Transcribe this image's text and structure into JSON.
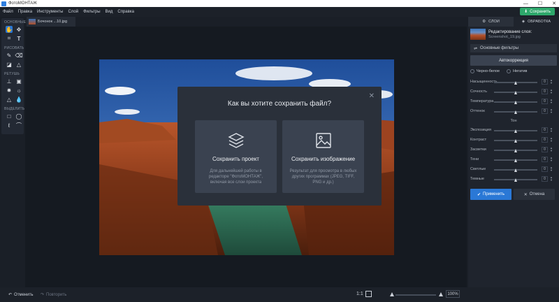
{
  "window": {
    "title": "ФотоМОНТАЖ",
    "controls": [
      "—",
      "☐",
      "✕"
    ]
  },
  "menu": [
    "Файл",
    "Правка",
    "Инструменты",
    "Слой",
    "Фильтры",
    "Вид",
    "Справка"
  ],
  "save_button": "Сохранить",
  "document_tab": "Бочонок ...10.jpg",
  "toolbar": {
    "sections": [
      "ОСНОВНЫЕ",
      "РИСОВАТЬ",
      "РЕТУШЬ",
      "ВЫДЕЛИТЬ"
    ]
  },
  "dialog": {
    "title": "Как вы хотите сохранить файл?",
    "cards": [
      {
        "title": "Сохранить проект",
        "description": "Для дальнейшей работы в редакторе \"ФотоМОНТАЖ\", включая все слои проекта"
      },
      {
        "title": "Сохранить изображение",
        "description": "Результат для просмотра в любых других программах (JPEG, TIFF, PNG и др.)"
      }
    ]
  },
  "bottombar": {
    "undo": "Отменить",
    "redo": "Повторить",
    "ratio": "1:1",
    "zoom": "100%"
  },
  "panel": {
    "tabs": [
      "СЛОИ",
      "ОБРАБОТКА"
    ],
    "layer_title": "Редактирование слоя:",
    "layer_name": "Screenshot_19.jpg",
    "filters_label": "Основные фильтры",
    "autocorrection": "Автокоррекция",
    "bw_label": "Черно-белое",
    "negative_label": "Негатив",
    "sliders": [
      {
        "label": "Насыщенность",
        "value": "0",
        "level": 0.5
      },
      {
        "label": "Сочность",
        "value": "0",
        "level": 0.5
      },
      {
        "label": "Температура",
        "value": "0",
        "level": 0.5
      },
      {
        "label": "Оттенок",
        "value": "0",
        "level": 0.5
      }
    ],
    "tone_section": "Тон",
    "tone_sliders": [
      {
        "label": "Экспозиция",
        "value": "0",
        "level": 0.5
      },
      {
        "label": "Контраст",
        "value": "0",
        "level": 0.5
      },
      {
        "label": "Засветки",
        "value": "0",
        "level": 0.5
      },
      {
        "label": "Тени",
        "value": "0",
        "level": 0.5
      },
      {
        "label": "Светлые",
        "value": "0",
        "level": 0.5
      },
      {
        "label": "Темные",
        "value": "0",
        "level": 0.5
      }
    ],
    "apply": "Применить",
    "cancel": "Отмена"
  },
  "colors": {
    "accent": "#2a78d6",
    "save": "#2da86b"
  }
}
